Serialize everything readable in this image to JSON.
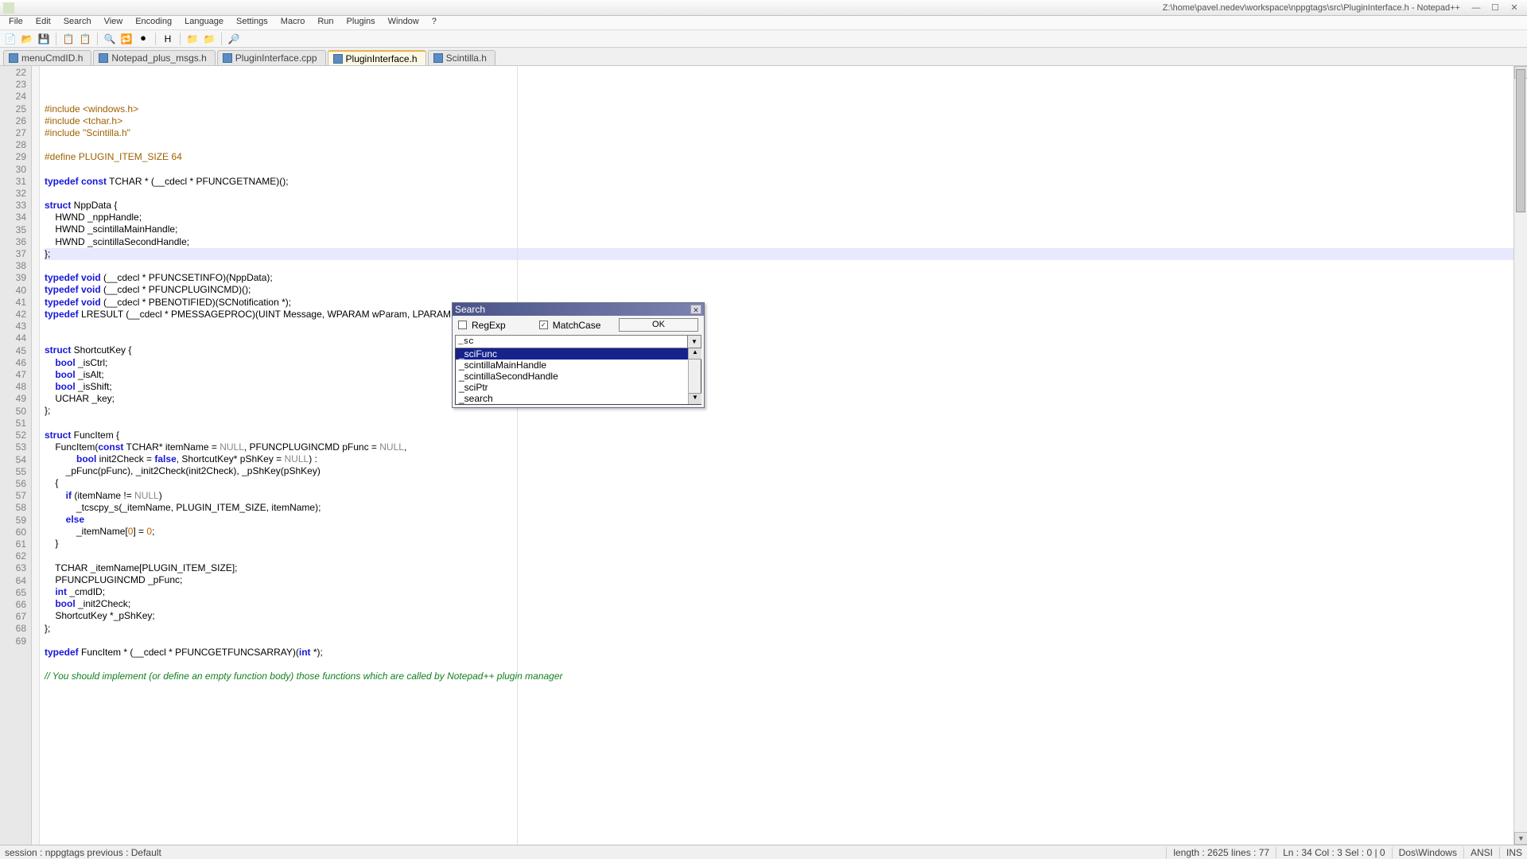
{
  "window": {
    "title_path": "Z:\\home\\pavel.nedev\\workspace\\nppgtags\\src\\PluginInterface.h - Notepad++"
  },
  "menu": [
    "File",
    "Edit",
    "Search",
    "View",
    "Encoding",
    "Language",
    "Settings",
    "Macro",
    "Run",
    "Plugins",
    "Window",
    "?"
  ],
  "tabs": [
    {
      "label": "menuCmdID.h"
    },
    {
      "label": "Notepad_plus_msgs.h"
    },
    {
      "label": "PluginInterface.cpp"
    },
    {
      "label": "PluginInterface.h"
    },
    {
      "label": "Scintilla.h"
    }
  ],
  "active_tab": 3,
  "first_line": 22,
  "code": [
    {
      "n": 22,
      "h": "<span class='pp'>#include &lt;windows.h&gt;</span>"
    },
    {
      "n": 23,
      "h": "<span class='pp'>#include &lt;tchar.h&gt;</span>"
    },
    {
      "n": 24,
      "h": "<span class='pp'>#include \"Scintilla.h\"</span>"
    },
    {
      "n": 25,
      "h": ""
    },
    {
      "n": 26,
      "h": "<span class='pp'>#define PLUGIN_ITEM_SIZE 64</span>"
    },
    {
      "n": 27,
      "h": ""
    },
    {
      "n": 28,
      "h": "<span class='kw'>typedef</span> <span class='kw'>const</span> TCHAR * (__cdecl * PFUNCGETNAME)();"
    },
    {
      "n": 29,
      "h": ""
    },
    {
      "n": 30,
      "h": "<span class='kw'>struct</span> NppData {"
    },
    {
      "n": 31,
      "h": "    HWND _nppHandle;"
    },
    {
      "n": 32,
      "h": "    HWND _scintillaMainHandle;"
    },
    {
      "n": 33,
      "h": "    HWND _scintillaSecondHandle;"
    },
    {
      "n": 34,
      "h": "};",
      "hl": true
    },
    {
      "n": 35,
      "h": ""
    },
    {
      "n": 36,
      "h": "<span class='kw'>typedef</span> <span class='kw'>void</span> (__cdecl * PFUNCSETINFO)(NppData);"
    },
    {
      "n": 37,
      "h": "<span class='kw'>typedef</span> <span class='kw'>void</span> (__cdecl * PFUNCPLUGINCMD)();"
    },
    {
      "n": 38,
      "h": "<span class='kw'>typedef</span> <span class='kw'>void</span> (__cdecl * PBENOTIFIED)(SCNotification *);"
    },
    {
      "n": 39,
      "h": "<span class='kw'>typedef</span> LRESULT (__cdecl * PMESSAGEPROC)(UINT Message, WPARAM wParam, LPARAM lParam);"
    },
    {
      "n": 40,
      "h": ""
    },
    {
      "n": 41,
      "h": ""
    },
    {
      "n": 42,
      "h": "<span class='kw'>struct</span> ShortcutKey {"
    },
    {
      "n": 43,
      "h": "    <span class='kw'>bool</span> _isCtrl;"
    },
    {
      "n": 44,
      "h": "    <span class='kw'>bool</span> _isAlt;"
    },
    {
      "n": 45,
      "h": "    <span class='kw'>bool</span> _isShift;"
    },
    {
      "n": 46,
      "h": "    UCHAR _key;"
    },
    {
      "n": 47,
      "h": "};"
    },
    {
      "n": 48,
      "h": ""
    },
    {
      "n": 49,
      "h": "<span class='kw'>struct</span> FuncItem {"
    },
    {
      "n": 50,
      "h": "    FuncItem(<span class='kw'>const</span> TCHAR* itemName = <span class='lit'>NULL</span>, PFUNCPLUGINCMD pFunc = <span class='lit'>NULL</span>,"
    },
    {
      "n": 51,
      "h": "            <span class='kw'>bool</span> init2Check = <span class='kw'>false</span>, ShortcutKey* pShKey = <span class='lit'>NULL</span>) :"
    },
    {
      "n": 52,
      "h": "        _pFunc(pFunc), _init2Check(init2Check), _pShKey(pShKey)"
    },
    {
      "n": 53,
      "h": "    {"
    },
    {
      "n": 54,
      "h": "        <span class='kw'>if</span> (itemName != <span class='lit'>NULL</span>)"
    },
    {
      "n": 55,
      "h": "            _tcscpy_s(_itemName, PLUGIN_ITEM_SIZE, itemName);"
    },
    {
      "n": 56,
      "h": "        <span class='kw'>else</span>"
    },
    {
      "n": 57,
      "h": "            _itemName[<span class='num'>0</span>] = <span class='num'>0</span>;"
    },
    {
      "n": 58,
      "h": "    }"
    },
    {
      "n": 59,
      "h": ""
    },
    {
      "n": 60,
      "h": "    TCHAR _itemName[PLUGIN_ITEM_SIZE];"
    },
    {
      "n": 61,
      "h": "    PFUNCPLUGINCMD _pFunc;"
    },
    {
      "n": 62,
      "h": "    <span class='kw'>int</span> _cmdID;"
    },
    {
      "n": 63,
      "h": "    <span class='kw'>bool</span> _init2Check;"
    },
    {
      "n": 64,
      "h": "    ShortcutKey *_pShKey;"
    },
    {
      "n": 65,
      "h": "};"
    },
    {
      "n": 66,
      "h": ""
    },
    {
      "n": 67,
      "h": "<span class='kw'>typedef</span> FuncItem * (__cdecl * PFUNCGETFUNCSARRAY)(<span class='kw'>int</span> *);"
    },
    {
      "n": 68,
      "h": ""
    },
    {
      "n": 69,
      "h": "<span class='cmt'>// You should implement (or define an empty function body) those functions which are called by Notepad++ plugin manager</span>"
    }
  ],
  "search_dialog": {
    "title": "Search",
    "regexp_label": "RegExp",
    "regexp_checked": false,
    "matchcase_label": "MatchCase",
    "matchcase_checked": true,
    "ok_label": "OK",
    "input_value": "_sc",
    "suggestions": [
      "_sciFunc",
      "_scintillaMainHandle",
      "_scintillaSecondHandle",
      "_sciPtr",
      "_search"
    ],
    "selected_suggestion": 0
  },
  "status": {
    "left": "session : nppgtags    previous : Default",
    "length": "length : 2625    lines : 77",
    "pos": "Ln : 34    Col : 3    Sel : 0 | 0",
    "eol": "Dos\\Windows",
    "enc": "ANSI",
    "mode": "INS"
  }
}
